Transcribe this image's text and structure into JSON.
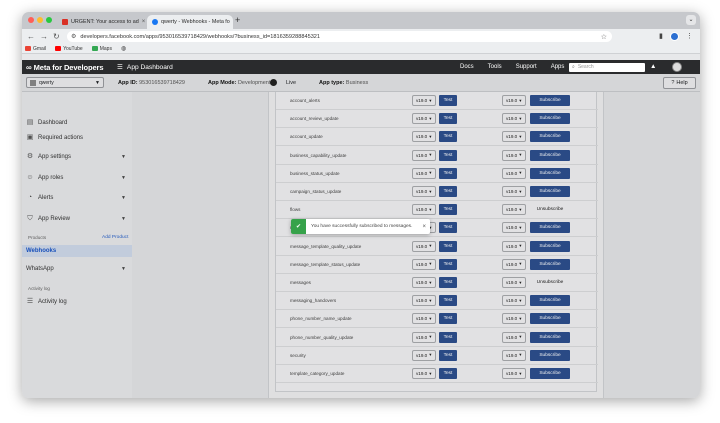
{
  "browser": {
    "tabs": [
      {
        "title": "URGENT: Your access to ad",
        "favicon_color": "#d93025"
      },
      {
        "title": "qwerty - Webhooks - Meta fo",
        "favicon_color": "#1877f2"
      }
    ],
    "url": "developers.facebook.com/apps/953016539718429/webhooks/?business_id=1816359288845321",
    "bookmarks": [
      {
        "label": "Gmail",
        "color": "#ea4335"
      },
      {
        "label": "YouTube",
        "color": "#ff0000"
      },
      {
        "label": "Maps",
        "color": "#34a853"
      }
    ]
  },
  "meta_bar": {
    "logo": "Meta for Developers",
    "app_dashboard": "App Dashboard",
    "links": [
      "Docs",
      "Tools",
      "Support",
      "Apps"
    ],
    "search_placeholder": "Search"
  },
  "app_info": {
    "app_name": "qwerty",
    "app_id_label": "App ID:",
    "app_id": "953016539718429",
    "app_mode_label": "App Mode:",
    "app_mode": "Development",
    "live_label": "Live",
    "app_type_label": "App type:",
    "app_type": "Business",
    "help": "Help"
  },
  "sidebar": {
    "items": [
      {
        "label": "Dashboard",
        "icon": "dashboard-icon"
      },
      {
        "label": "Required actions",
        "icon": "clipboard-icon"
      },
      {
        "label": "App settings",
        "icon": "gear-icon"
      },
      {
        "label": "App roles",
        "icon": "user-icon"
      },
      {
        "label": "Alerts",
        "icon": "bell-icon"
      },
      {
        "label": "App Review",
        "icon": "shield-icon"
      }
    ],
    "products_label": "Products",
    "add_product": "Add Product",
    "products": [
      {
        "label": "Webhooks"
      },
      {
        "label": "WhatsApp"
      }
    ],
    "activity_section": "Activity log",
    "activity_item": "Activity log"
  },
  "webhook_fields": {
    "rows": [
      {
        "name": "account_alerts",
        "version": "v19.0",
        "test": "Test",
        "version2": "v19.0",
        "action": "Subscribe"
      },
      {
        "name": "account_review_update",
        "version": "v19.0",
        "test": "Test",
        "version2": "v19.0",
        "action": "Subscribe"
      },
      {
        "name": "account_update",
        "version": "v19.0",
        "test": "Test",
        "version2": "v19.0",
        "action": "Subscribe"
      },
      {
        "name": "business_capability_update",
        "version": "v19.0",
        "test": "Test",
        "version2": "v19.0",
        "action": "Subscribe"
      },
      {
        "name": "business_status_update",
        "version": "v19.0",
        "test": "Test",
        "version2": "v19.0",
        "action": "Subscribe"
      },
      {
        "name": "campaign_status_update",
        "version": "v19.0",
        "test": "Test",
        "version2": "v19.0",
        "action": "Subscribe"
      },
      {
        "name": "flows",
        "version": "v19.0",
        "test": "Test",
        "version2": "v19.0",
        "action": "Unsubscribe"
      },
      {
        "name": "message_e",
        "version": "v19.0",
        "test": "Test",
        "version2": "v19.0",
        "action": "Subscribe"
      },
      {
        "name": "message_template_quality_update",
        "version": "v19.0",
        "test": "Test",
        "version2": "v19.0",
        "action": "Subscribe"
      },
      {
        "name": "message_template_status_update",
        "version": "v19.0",
        "test": "Test",
        "version2": "v19.0",
        "action": "Subscribe"
      },
      {
        "name": "messages",
        "version": "v19.0",
        "test": "Test",
        "version2": "v19.0",
        "action": "Unsubscribe"
      },
      {
        "name": "messaging_handovers",
        "version": "v19.0",
        "test": "Test",
        "version2": "v19.0",
        "action": "Subscribe"
      },
      {
        "name": "phone_number_name_update",
        "version": "v19.0",
        "test": "Test",
        "version2": "v19.0",
        "action": "Subscribe"
      },
      {
        "name": "phone_number_quality_update",
        "version": "v19.0",
        "test": "Test",
        "version2": "v19.0",
        "action": "Subscribe"
      },
      {
        "name": "security",
        "version": "v19.0",
        "test": "Test",
        "version2": "v19.0",
        "action": "Subscribe"
      },
      {
        "name": "template_category_update",
        "version": "v19.0",
        "test": "Test",
        "version2": "v19.0",
        "action": "Subscribe"
      }
    ]
  },
  "toast": {
    "message": "You have successfully subscribed to messages.",
    "color": "#36a24a"
  },
  "colors": {
    "button_primary": "#2d4f8e",
    "link": "#2a62c9"
  }
}
